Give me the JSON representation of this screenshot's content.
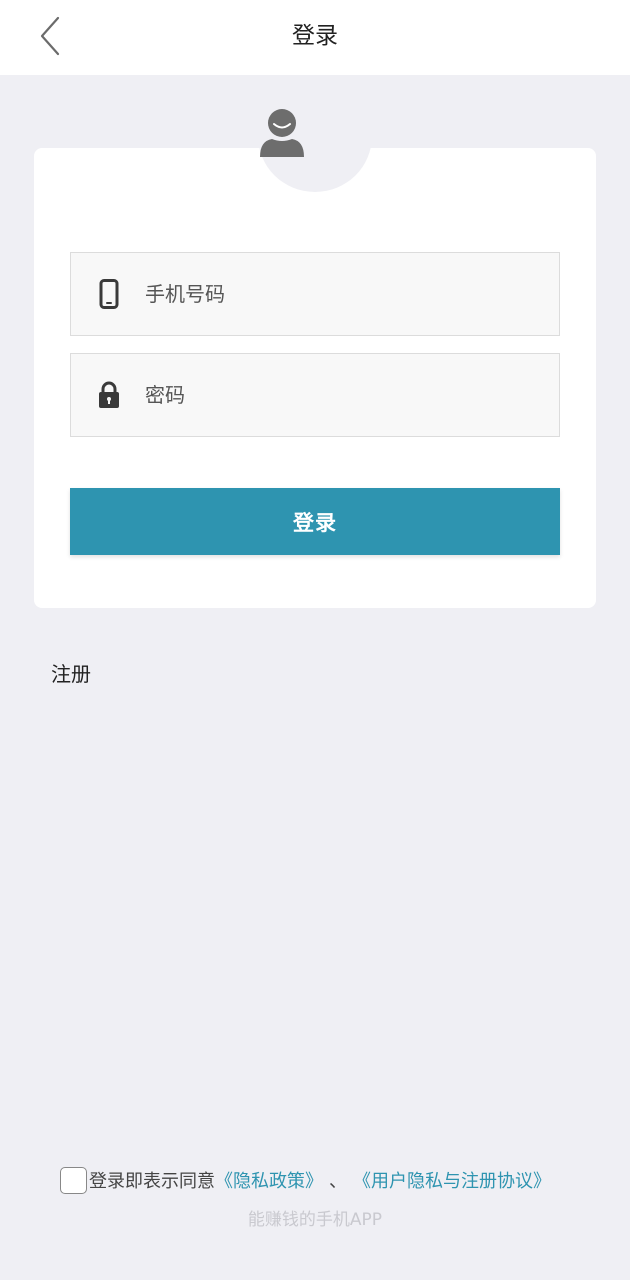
{
  "header": {
    "title": "登录",
    "back_icon": "chevron-left-icon"
  },
  "avatar": {
    "icon": "user-avatar-icon",
    "color": "#6d6d6d"
  },
  "form": {
    "phone": {
      "icon": "phone-icon",
      "placeholder": "手机号码",
      "value": ""
    },
    "password": {
      "icon": "lock-icon",
      "placeholder": "密码",
      "value": ""
    },
    "submit_label": "登录"
  },
  "register_label": "注册",
  "agreement": {
    "checked": false,
    "prefix": "登录即表示同意",
    "privacy_policy": "《隐私政策》",
    "separator": "、",
    "user_agreement": "《用户隐私与注册协议》"
  },
  "slogan": "能赚钱的手机APP",
  "colors": {
    "accent": "#2e94b0",
    "background": "#efeff4",
    "card": "#ffffff",
    "input_bg": "#f8f8f8",
    "slogan": "#c9c9cf"
  }
}
